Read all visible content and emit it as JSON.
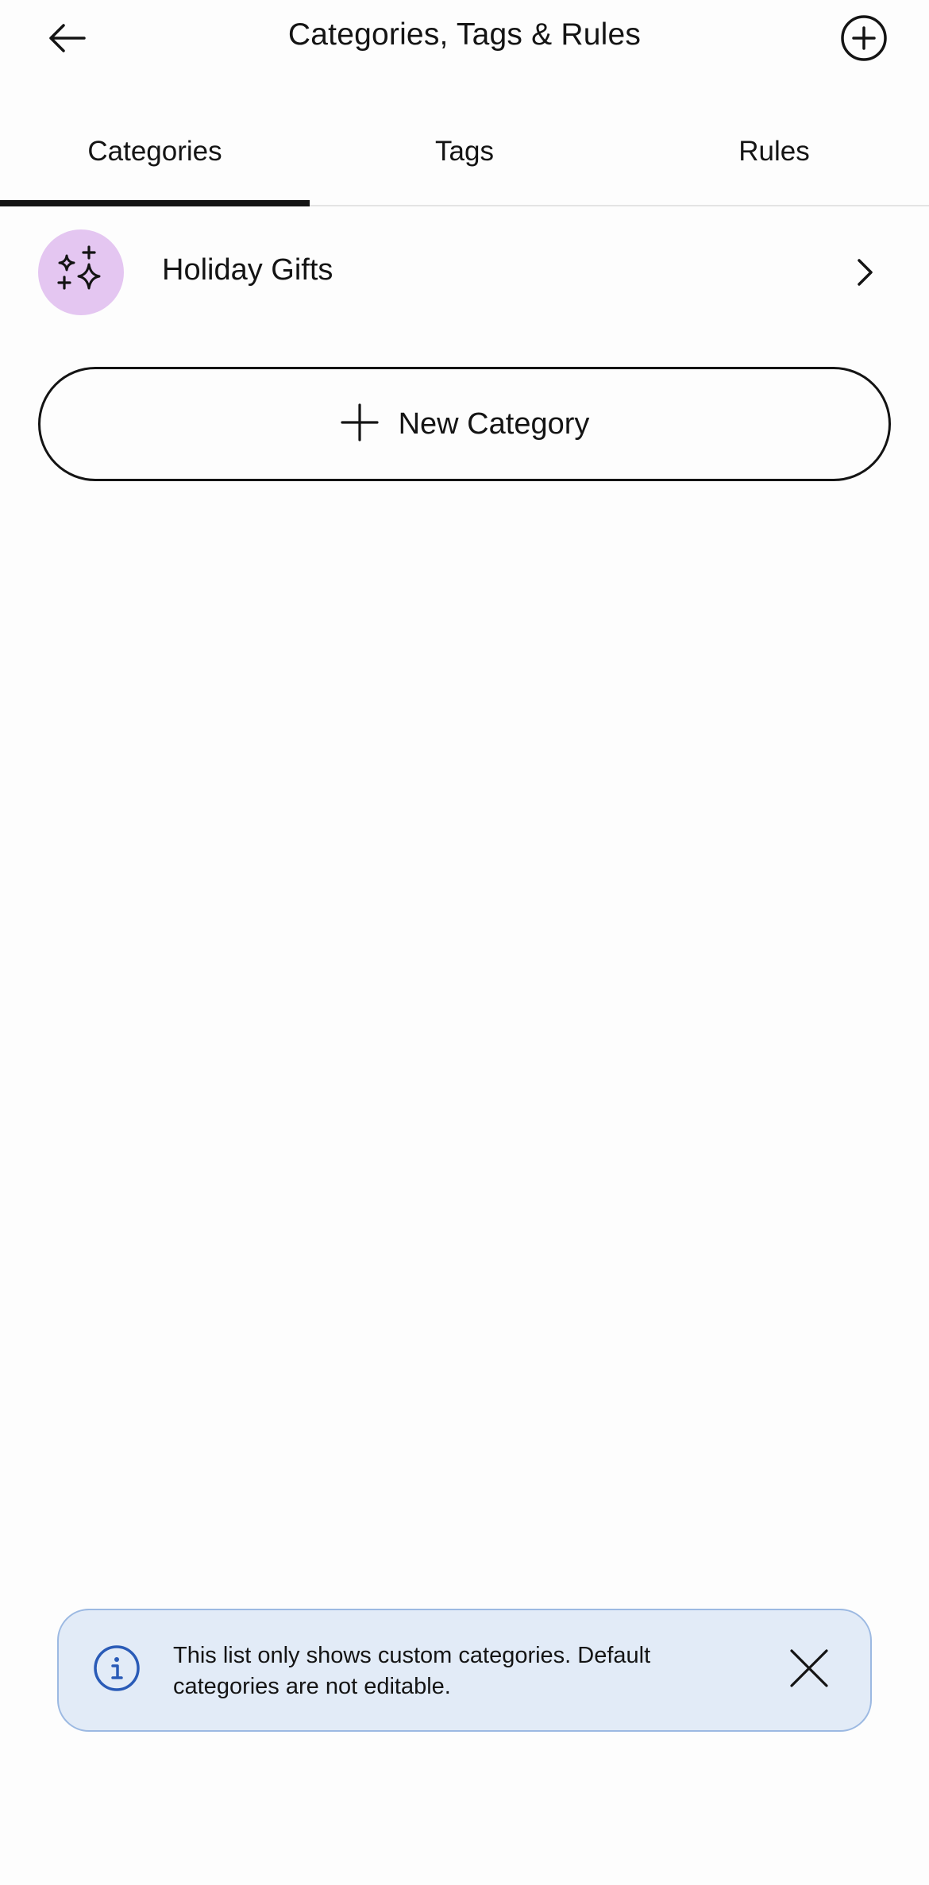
{
  "header": {
    "title": "Categories, Tags & Rules",
    "back_icon": "arrow-left-icon",
    "add_icon": "plus-circle-icon"
  },
  "tabs": [
    {
      "label": "Categories",
      "active": true
    },
    {
      "label": "Tags",
      "active": false
    },
    {
      "label": "Rules",
      "active": false
    }
  ],
  "categories": [
    {
      "label": "Holiday Gifts",
      "icon": "sparkles-icon",
      "icon_bg": "#e4c6f1"
    }
  ],
  "new_category_button": {
    "label": "New Category",
    "icon": "plus-icon"
  },
  "info_banner": {
    "text": "This list only shows custom categories. Default categories are not editable.",
    "icon": "info-icon",
    "icon_color": "#2a5bb7",
    "background": "#e2ebf7",
    "close_icon": "close-icon"
  }
}
